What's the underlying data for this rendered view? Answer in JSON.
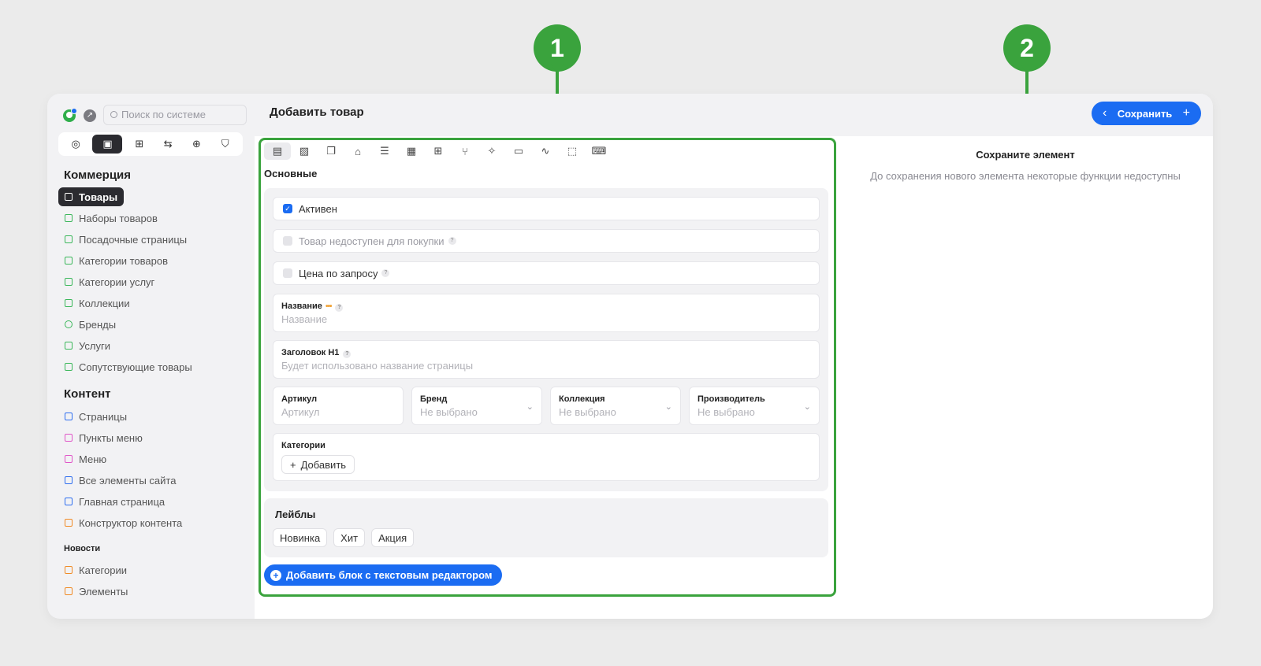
{
  "annotations": {
    "pin1": "1",
    "pin2": "2"
  },
  "header": {
    "search_placeholder": "Поиск по системе",
    "page_title": "Добавить товар",
    "save_label": "Сохранить"
  },
  "sidebar": {
    "commerce_title": "Коммерция",
    "commerce_items": [
      {
        "label": "Товары",
        "icon": "bag-icon"
      },
      {
        "label": "Наборы товаров",
        "icon": "bags-icon"
      },
      {
        "label": "Посадочные страницы",
        "icon": "page-icon"
      },
      {
        "label": "Категории товаров",
        "icon": "folder-icon"
      },
      {
        "label": "Категории услуг",
        "icon": "folder-icon"
      },
      {
        "label": "Коллекции",
        "icon": "collection-icon"
      },
      {
        "label": "Бренды",
        "icon": "brand-icon"
      },
      {
        "label": "Услуги",
        "icon": "service-icon"
      },
      {
        "label": "Сопутствующие товары",
        "icon": "filter-icon"
      }
    ],
    "content_title": "Контент",
    "content_items": [
      {
        "label": "Страницы",
        "icon": "grid-icon"
      },
      {
        "label": "Пункты меню",
        "icon": "list-icon"
      },
      {
        "label": "Меню",
        "icon": "menu-icon"
      },
      {
        "label": "Все элементы сайта",
        "icon": "layers-icon"
      },
      {
        "label": "Главная страница",
        "icon": "home-icon"
      },
      {
        "label": "Конструктор контента",
        "icon": "builder-icon"
      }
    ],
    "news_title": "Новости",
    "news_items": [
      {
        "label": "Категории",
        "icon": "folder-icon"
      },
      {
        "label": "Элементы",
        "icon": "grid-icon"
      }
    ]
  },
  "main": {
    "section_label": "Основные",
    "active_checkbox": "Активен",
    "unavailable_checkbox": "Товар недоступен для покупки",
    "price_on_request_checkbox": "Цена по запросу",
    "name_label": "Название",
    "name_placeholder": "Название",
    "h1_label": "Заголовок H1",
    "h1_placeholder": "Будет использовано название страницы",
    "sku_label": "Артикул",
    "sku_placeholder": "Артикул",
    "brand_label": "Бренд",
    "brand_value": "Не выбрано",
    "collection_label": "Коллекция",
    "collection_value": "Не выбрано",
    "maker_label": "Производитель",
    "maker_value": "Не выбрано",
    "categories_label": "Категории",
    "categories_add": "Добавить",
    "labels_title": "Лейблы",
    "labels": [
      "Новинка",
      "Хит",
      "Акция"
    ],
    "add_block": "Добавить блок с текстовым редактором"
  },
  "right_panel": {
    "title": "Сохраните элемент",
    "subtitle": "До сохранения нового элемента некоторые функции недоступны"
  },
  "colors": {
    "accent": "#1b6cf2",
    "annotation": "#3aa33d",
    "nav_active": "#2b2b30"
  }
}
